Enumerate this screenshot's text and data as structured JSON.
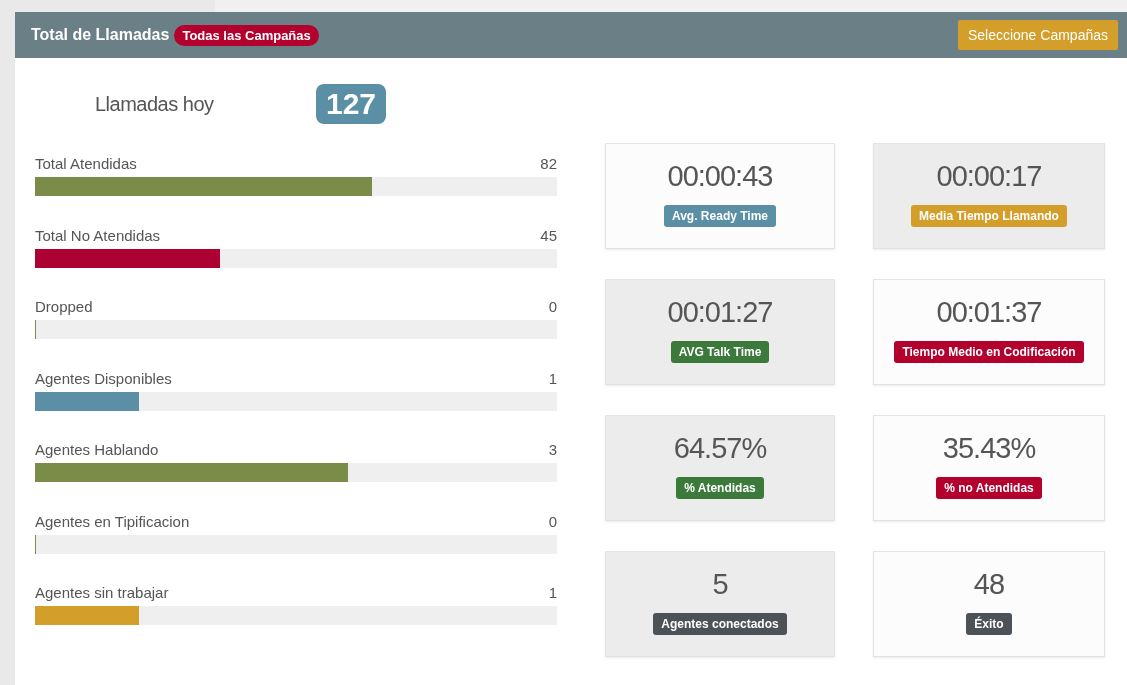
{
  "header": {
    "title": "Total de Llamadas",
    "badge": "Todas las Campañas",
    "button": "Seleccione Campañas"
  },
  "today": {
    "label": "Llamadas hoy",
    "count": "127"
  },
  "stats": [
    {
      "label": "Total Atendidas",
      "value": "82",
      "level": 0.646,
      "color": "#7a8c47"
    },
    {
      "label": "Total No Atendidas",
      "value": "45",
      "level": 0.354,
      "color": "#ad0033"
    },
    {
      "label": "Dropped",
      "value": "0",
      "level": 0,
      "color": "#7a8c47"
    },
    {
      "label": "Agentes Disponibles",
      "value": "1",
      "level": 0.2,
      "color": "#5b8fa6"
    },
    {
      "label": "Agentes Hablando",
      "value": "3",
      "level": 0.6,
      "color": "#7a8c47"
    },
    {
      "label": "Agentes en Tipificacion",
      "value": "0",
      "level": 0,
      "color": "#7a8c47"
    },
    {
      "label": "Agentes sin trabajar",
      "value": "1",
      "level": 0.2,
      "color": "#d39e2a"
    }
  ],
  "tiles": [
    {
      "value": "00:00:43",
      "label": "Avg. Ready Time",
      "color": "#5b8fa6",
      "shaded": false
    },
    {
      "value": "00:00:17",
      "label": "Media Tiempo Llamando",
      "color": "#d39e2a",
      "shaded": true
    },
    {
      "value": "00:01:27",
      "label": "AVG Talk Time",
      "color": "#3c7a3c",
      "shaded": true
    },
    {
      "value": "00:01:37",
      "label": "Tiempo Medio en Codificación",
      "color": "#b3002d",
      "shaded": false
    },
    {
      "value": "64.57%",
      "label": "% Atendidas",
      "color": "#3c7a3c",
      "shaded": true
    },
    {
      "value": "35.43%",
      "label": "% no Atendidas",
      "color": "#b3002d",
      "shaded": false
    },
    {
      "value": "5",
      "label": "Agentes conectados",
      "color": "#4d5259",
      "shaded": true
    },
    {
      "value": "48",
      "label": "Éxito",
      "color": "#4d5259",
      "shaded": false
    }
  ]
}
